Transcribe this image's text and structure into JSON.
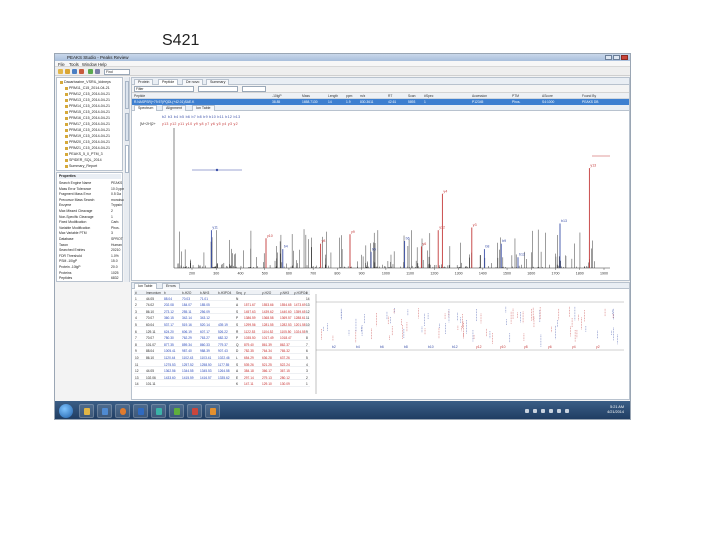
{
  "slide": {
    "title": "S421"
  },
  "window": {
    "title": "PEAKS Studio - Peaks Review",
    "menus": [
      "File",
      "Tools",
      "Window",
      "Help"
    ]
  },
  "toolbar": {
    "search_placeholder": "Find"
  },
  "project_tree": {
    "items": [
      "Dacarbazine_VSRIL_kidneys",
      "PRM11_C15_2014-04-21",
      "PRM12_C15_2014-04-21",
      "PRM13_C15_2014-04-21",
      "PRM14_C15_2014-04-21",
      "PRM15_C15_2014-04-21",
      "PRM16_C15_2014-04-21",
      "PRM17_C15_2014-04-21",
      "PRM18_C15_2014-04-21",
      "PRM19_C15_2014-04-21",
      "PRM20_C15_2014-04-21",
      "PRM21_C15_2014-04-21",
      "PEAKS_5_0_PTM_3",
      "SPIDER_SQL_2014",
      "Summary_Report"
    ]
  },
  "properties": {
    "title": "Properties",
    "rows": [
      {
        "k": "Search Engine Name",
        "v": "PEAKS"
      },
      {
        "k": "Mass Error Tolerance",
        "v": "10.0 ppm"
      },
      {
        "k": "Fragment Mass Error",
        "v": "0.5 Da"
      },
      {
        "k": "Precursor Mass Search",
        "v": "monoiso"
      },
      {
        "k": "Enzyme",
        "v": "Trypsin"
      },
      {
        "k": "Max Missed Cleavage",
        "v": "2"
      },
      {
        "k": "Non-Specific Cleavage",
        "v": "1"
      },
      {
        "k": "Fixed Modification",
        "v": "Carb."
      },
      {
        "k": "Variable Modification",
        "v": "Phos."
      },
      {
        "k": "Max Variable PTM",
        "v": "3"
      },
      {
        "k": "Database",
        "v": "SPROT"
      },
      {
        "k": "Taxon",
        "v": "Human"
      },
      {
        "k": "Searched Entries",
        "v": "20210"
      },
      {
        "k": "FDR Threshold",
        "v": "1.0%"
      },
      {
        "k": "PSM -10lgP",
        "v": "15.0"
      },
      {
        "k": "Protein -10lgP",
        "v": "20.0"
      },
      {
        "k": "Proteins",
        "v": "1025"
      },
      {
        "k": "Peptides",
        "v": "6832"
      }
    ]
  },
  "peptide_panel": {
    "tabs": [
      "Protein",
      "Peptide",
      "De novo",
      "Summary"
    ],
    "filter_placeholder": "Filter",
    "columns": [
      "Peptide",
      "-10lgP",
      "Mass",
      "Length",
      "ppm",
      "m/z",
      "RT",
      "Scan",
      "#Spec",
      "Accession",
      "PTM",
      "AScore",
      "Found By"
    ],
    "selected_row": {
      "peptide": "R.NASPSR(+79.97)PQDL(+42.01)SAE.K",
      "score": "38.85",
      "mass": "1658.7130",
      "length": "14",
      "ppm": "1.9",
      "mz": "830.3611",
      "rt": "42.61",
      "scan": "5893",
      "spec": "1",
      "accession": "P12345",
      "ptm": "Phos.",
      "ascore": "S4:1000",
      "found_by": "PEAKS DB"
    },
    "spectrum_tabs": [
      "Spectrum",
      "Alignment",
      "Ion Table"
    ]
  },
  "spectrum": {
    "precursor_label": "[M+2H]2+",
    "ion_ladder_b": "b2 b3 b4 b5 b6 b7 b8 b9 b10 b11 b12 b13",
    "ion_ladder_y": "y13 y12 y11 y10 y9 y8 y7 y6 y5 y4 y3 y2",
    "x_ticks": [
      "200",
      "300",
      "400",
      "500",
      "600",
      "700",
      "800",
      "900",
      "1000",
      "1100",
      "1200",
      "1300",
      "1400",
      "1500",
      "1600",
      "1700",
      "1800",
      "1900"
    ],
    "annotations": [
      "y11",
      "y10",
      "b4",
      "y8",
      "y9",
      "b5",
      "b6",
      "y6",
      "y4",
      "y3",
      "b8",
      "b9",
      "b12",
      "b13",
      "y13",
      "y12"
    ]
  },
  "fragment_table": {
    "tabs": [
      "Ion Table",
      "Errors"
    ],
    "columns": [
      "#",
      "Immonium",
      "b",
      "b-H2O",
      "b-NH3",
      "b-H3PO4",
      "Seq",
      "y",
      "y-H2O",
      "y-NH3",
      "y-H3PO4",
      "#"
    ],
    "rows": [
      [
        "1",
        "44.05",
        "88.04",
        "70.03",
        "71.01",
        "",
        "N",
        "",
        "",
        "",
        "",
        "14"
      ],
      [
        "2",
        "74.02",
        "202.08",
        "184.07",
        "185.05",
        "",
        "A",
        "1571.67",
        "1553.66",
        "1554.65",
        "1473.69",
        "13"
      ],
      [
        "3",
        "86.10",
        "273.12",
        "255.11",
        "256.09",
        "",
        "S",
        "1457.63",
        "1439.62",
        "1440.60",
        "1359.65",
        "12"
      ],
      [
        "4",
        "70.07",
        "360.15",
        "342.14",
        "343.12",
        "",
        "P",
        "1386.59",
        "1368.58",
        "1369.57",
        "1288.61",
        "11"
      ],
      [
        "5",
        "60.04",
        "537.17",
        "519.16",
        "520.14",
        "439.19",
        "S",
        "1299.56",
        "1281.55",
        "1282.53",
        "1201.58",
        "10"
      ],
      [
        "6",
        "129.11",
        "624.20",
        "606.19",
        "607.17",
        "526.22",
        "R",
        "1122.53",
        "1104.52",
        "1105.50",
        "1024.55",
        "9"
      ],
      [
        "7",
        "70.07",
        "780.30",
        "762.29",
        "763.27",
        "682.32",
        "P",
        "1035.50",
        "1017.49",
        "1018.47",
        "",
        "8"
      ],
      [
        "8",
        "101.07",
        "877.35",
        "859.34",
        "860.33",
        "779.37",
        "Q",
        "879.40",
        "861.39",
        "862.37",
        "",
        "7"
      ],
      [
        "9",
        "88.04",
        "1005.41",
        "987.40",
        "988.39",
        "907.43",
        "D",
        "782.35",
        "764.34",
        "765.32",
        "",
        "6"
      ],
      [
        "10",
        "86.10",
        "1120.44",
        "1102.43",
        "1103.41",
        "1022.46",
        "L",
        "654.29",
        "636.28",
        "637.26",
        "",
        "5"
      ],
      [
        "11",
        "",
        "1275.53",
        "1257.52",
        "1258.50",
        "1177.55",
        "S",
        "539.26",
        "521.25",
        "522.24",
        "",
        "4"
      ],
      [
        "12",
        "44.05",
        "1362.56",
        "1344.55",
        "1345.53",
        "1264.58",
        "A",
        "384.18",
        "366.17",
        "367.15",
        "",
        "3"
      ],
      [
        "13",
        "102.06",
        "1433.60",
        "1415.59",
        "1416.57",
        "1335.62",
        "E",
        "297.14",
        "279.13",
        "280.12",
        "",
        "2"
      ],
      [
        "14",
        "101.11",
        "",
        "",
        "",
        "",
        "K",
        "147.11",
        "129.10",
        "130.09",
        "",
        "1"
      ]
    ]
  },
  "alignment": {
    "labels": [
      "b2",
      "b4",
      "b6",
      "b8",
      "b10",
      "b12",
      "y12",
      "y10",
      "y8",
      "y6",
      "y4",
      "y2"
    ]
  },
  "taskbar": {
    "time": "5:21 AM",
    "date": "4/21/2014"
  },
  "colors": {
    "b_ion": "#3a4fa8",
    "y_ion": "#c43a3a",
    "selection": "#3d7fd0",
    "taskbar": "#1d3a5f"
  }
}
